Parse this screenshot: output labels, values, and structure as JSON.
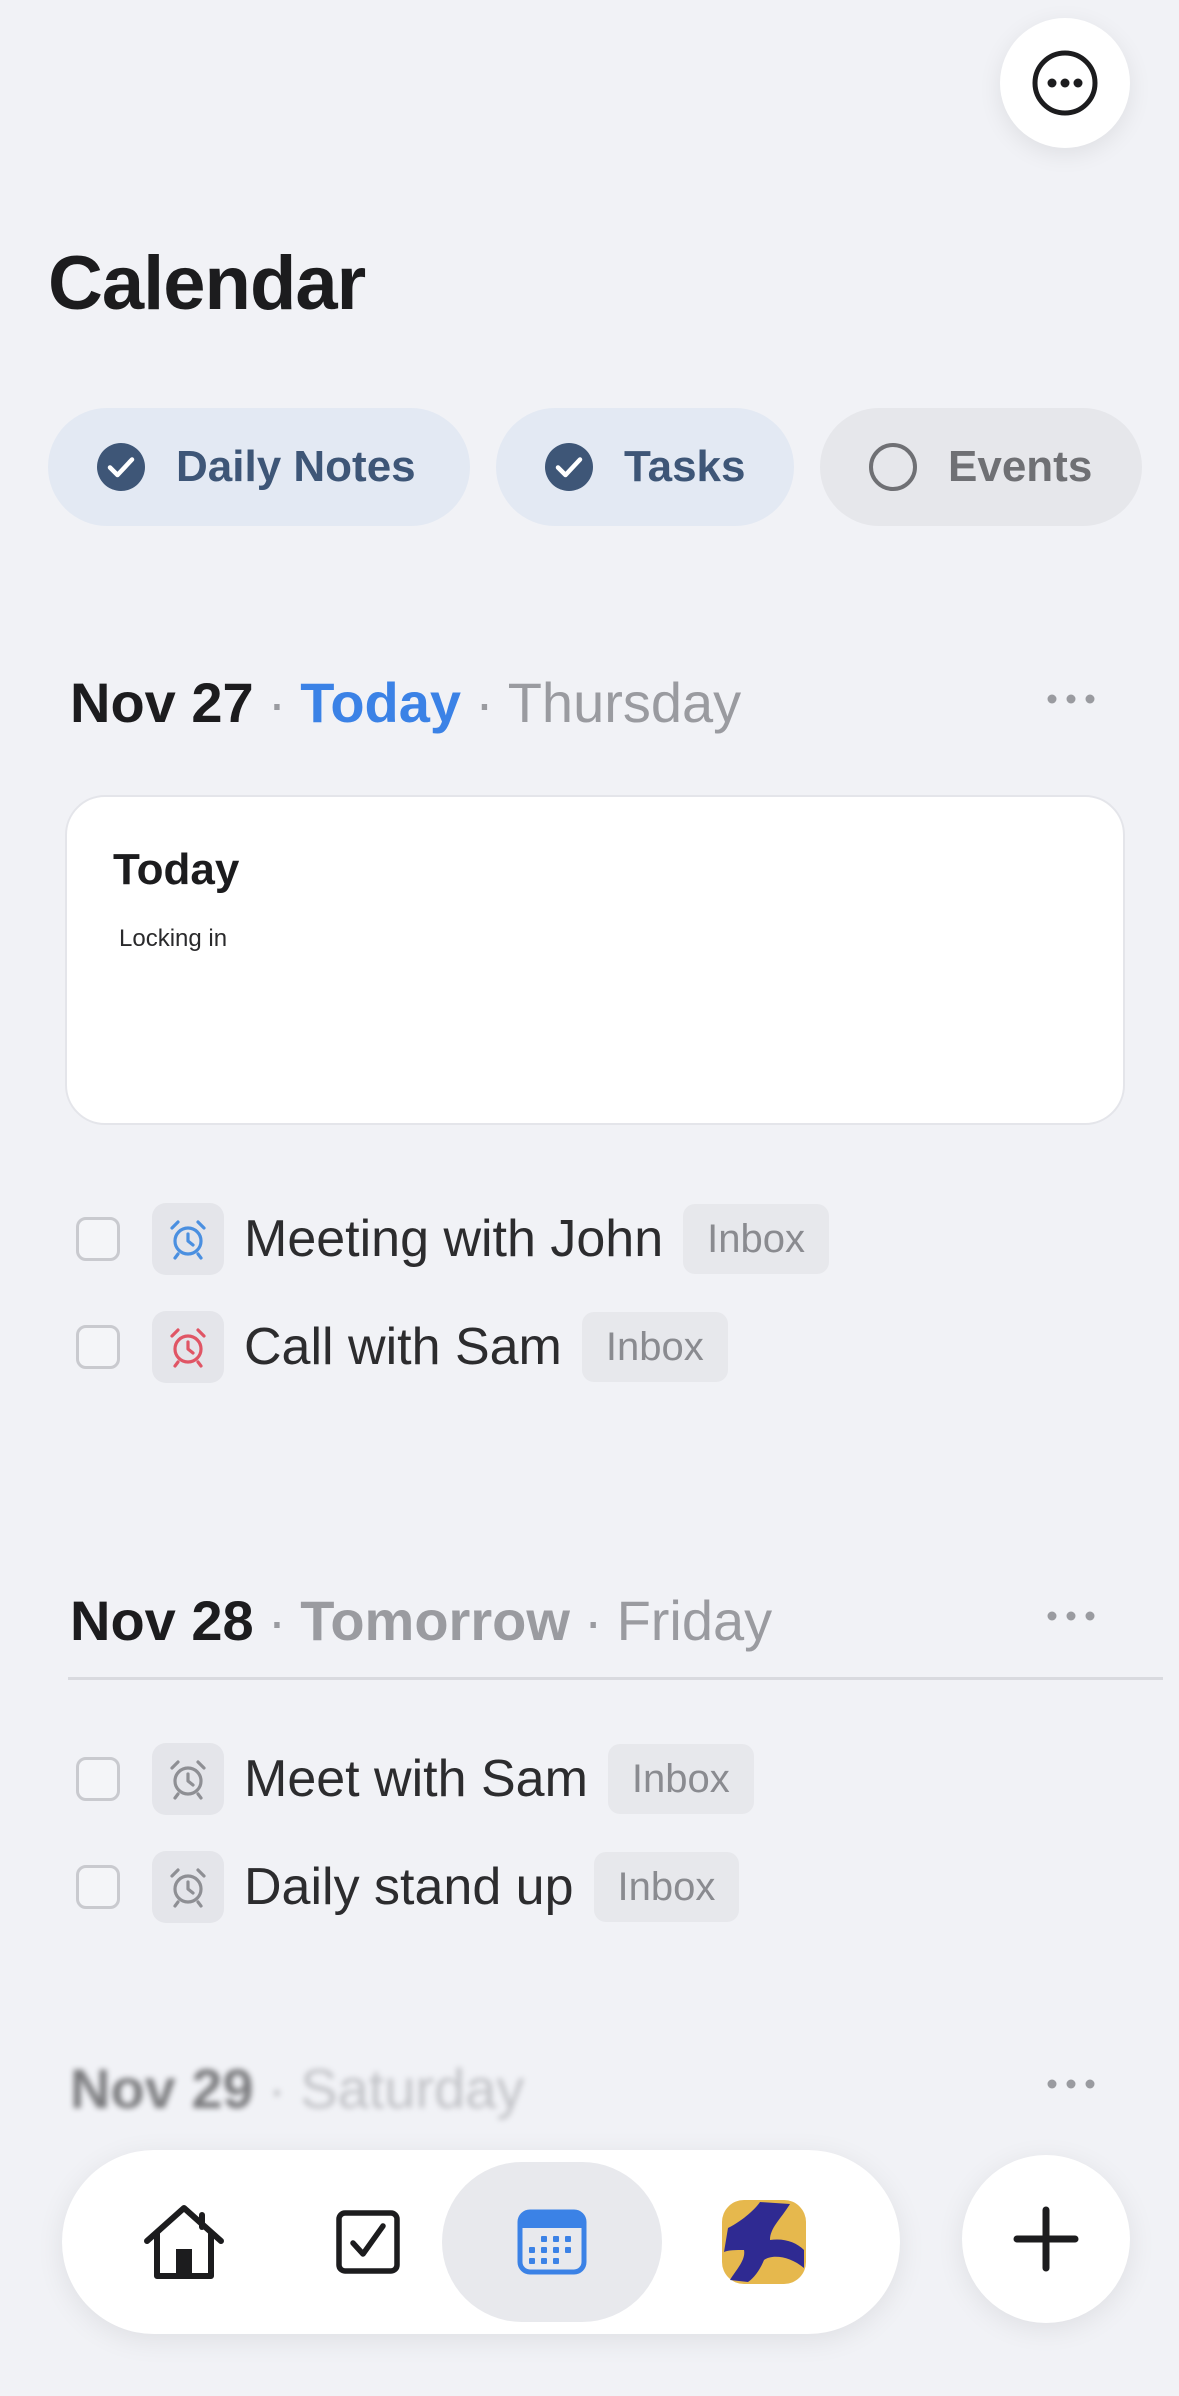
{
  "header": {
    "title": "Calendar"
  },
  "filters": [
    {
      "label": "Daily Notes",
      "checked": true
    },
    {
      "label": "Tasks",
      "checked": true
    },
    {
      "label": "Events",
      "checked": false
    }
  ],
  "days": [
    {
      "date": "Nov 27",
      "relative": "Today",
      "weekday": "Thursday",
      "note": {
        "title": "Today",
        "body": "Locking in"
      },
      "tasks": [
        {
          "title": "Meeting with John",
          "tag": "Inbox",
          "alarm_color": "#4a8fe0"
        },
        {
          "title": "Call with Sam",
          "tag": "Inbox",
          "alarm_color": "#e05565"
        }
      ]
    },
    {
      "date": "Nov 28",
      "relative": "Tomorrow",
      "weekday": "Friday",
      "tasks": [
        {
          "title": "Meet with Sam",
          "tag": "Inbox",
          "alarm_color": "#8e8f94"
        },
        {
          "title": "Daily stand up",
          "tag": "Inbox",
          "alarm_color": "#8e8f94"
        }
      ]
    },
    {
      "date": "Nov 29",
      "weekday": "Saturday"
    }
  ],
  "tabbar": {
    "tabs": [
      {
        "icon": "home-icon"
      },
      {
        "icon": "checkbox-icon"
      },
      {
        "icon": "calendar-icon",
        "active": true
      },
      {
        "icon": "app-logo-icon"
      }
    ]
  },
  "fab": {
    "icon": "plus-icon"
  },
  "colors": {
    "accent": "#3b82e6",
    "chip_on": "#3e5677",
    "background": "#f1f2f6"
  }
}
